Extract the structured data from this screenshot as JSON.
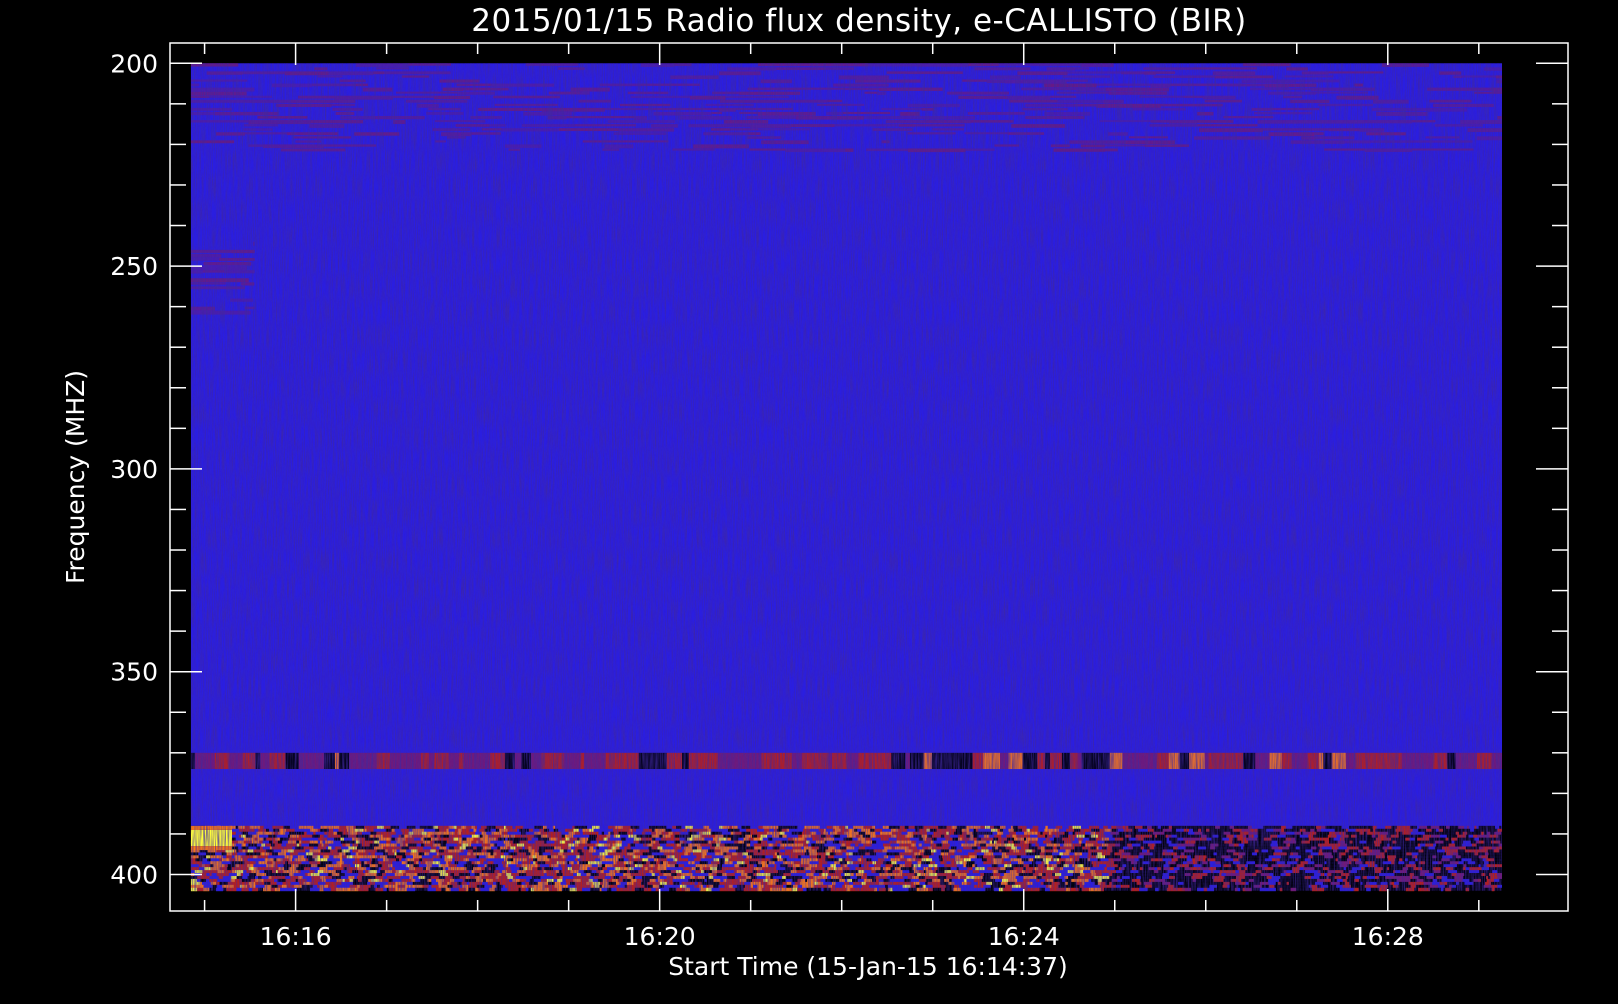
{
  "chart_data": {
    "type": "heatmap",
    "title": "2015/01/15  Radio flux density, e-CALLISTO (BIR)",
    "xlabel": "Start Time (15-Jan-15 16:14:37)",
    "ylabel": "Frequency (MHZ)",
    "x_tick_labels": [
      "16:16",
      "16:20",
      "16:24",
      "16:28"
    ],
    "x_tick_minutes": [
      16.0,
      20.0,
      24.0,
      28.0
    ],
    "x_range_minutes": [
      14.62,
      29.98
    ],
    "y_tick_labels": [
      "200",
      "250",
      "300",
      "350",
      "400"
    ],
    "y_tick_values": [
      200,
      250,
      300,
      350,
      400
    ],
    "y_range": [
      195,
      409
    ],
    "data_y_range": [
      200,
      404
    ],
    "y_inverted": true,
    "background": "#000000",
    "colors": {
      "background_level": "#2a1ee0",
      "weak_emission": "#7a1a6a",
      "moderate_emission": "#c0200e",
      "strong_emission": "#ff7a10",
      "peak_emission": "#ffff3c",
      "absorption": "#000000"
    },
    "features": [
      {
        "name": "interference band",
        "freq_mhz": [
          200,
          222
        ],
        "minutes": [
          14.85,
          29.98
        ],
        "level": "weak"
      },
      {
        "name": "persistent line",
        "freq_mhz": [
          244,
          262
        ],
        "minutes": [
          14.85,
          15.55
        ],
        "level": "weak"
      },
      {
        "name": "persistent line",
        "freq_mhz": [
          370,
          374
        ],
        "minutes": [
          14.85,
          29.98
        ],
        "level": "moderate"
      },
      {
        "name": "persistent band",
        "freq_mhz": [
          388,
          404
        ],
        "minutes": [
          14.85,
          29.98
        ],
        "level": "strong"
      },
      {
        "name": "brightest emission",
        "freq_mhz": [
          389,
          393
        ],
        "minutes": [
          14.85,
          15.3
        ],
        "level": "peak"
      }
    ]
  }
}
